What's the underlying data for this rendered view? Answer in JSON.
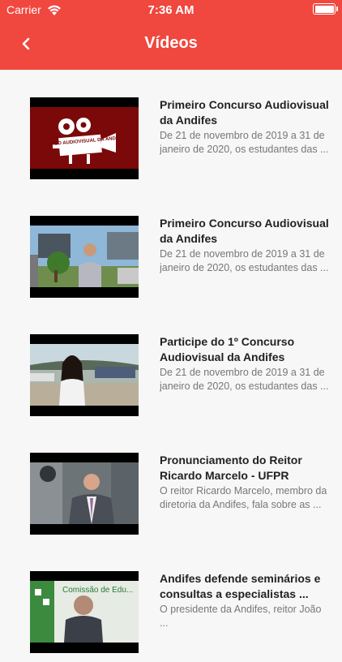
{
  "status_bar": {
    "carrier": "Carrier",
    "time": "7:36 AM"
  },
  "header": {
    "title": "Vídeos",
    "back_icon": "chevron-left-icon",
    "color": "#f0473e"
  },
  "videos": [
    {
      "title": "Primeiro Concurso Audiovisual da Andifes",
      "description": "De 21 de novembro de 2019 a 31 de janeiro de 2020, os estudantes das ...",
      "thumb_text": "CONCURSO AUDIOVISUAL DA ANDIFES"
    },
    {
      "title": "Primeiro Concurso Audiovisual da Andifes",
      "description": "De 21 de novembro de 2019 a 31 de janeiro de 2020, os estudantes das ...",
      "thumb_text": ""
    },
    {
      "title": "Participe do 1º Concurso Audiovisual da Andifes",
      "description": "De 21 de novembro de 2019 a 31 de janeiro de 2020, os estudantes das ...",
      "thumb_text": ""
    },
    {
      "title": "Pronunciamento do Reitor Ricardo Marcelo - UFPR",
      "description": "O reitor Ricardo Marcelo, membro da diretoria da Andifes, fala sobre as ...",
      "thumb_text": ""
    },
    {
      "title": "Andifes defende seminários e consultas a especialistas ...",
      "description": "O presidente da Andifes, reitor João ...",
      "thumb_text": "Comissão de Edu..."
    }
  ]
}
